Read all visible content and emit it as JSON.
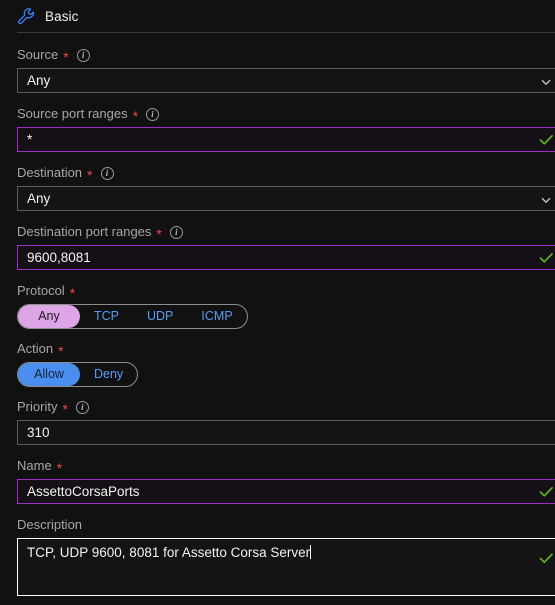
{
  "section": {
    "title": "Basic",
    "icon": "wrench-icon"
  },
  "colors": {
    "background": "#111111",
    "input_border": "#5c5c5c",
    "autofill_border": "#9b30c9",
    "focus_border": "#ffffff",
    "valid_check": "#5fb02c",
    "required_star": "#e74c4c",
    "link_blue": "#5b9bf0",
    "selected_purple": "#dda4e6",
    "selected_blue": "#4a8ff0",
    "label_text": "#a7a7a7",
    "value_text": "#f2f2f2"
  },
  "fields": {
    "source": {
      "label": "Source",
      "required": true,
      "info": true,
      "value": "Any",
      "type": "dropdown",
      "state": "default"
    },
    "source_port_ranges": {
      "label": "Source port ranges",
      "required": true,
      "info": true,
      "value": "*",
      "placeholder": "",
      "type": "text",
      "state": "autofill",
      "valid": true
    },
    "destination": {
      "label": "Destination",
      "required": true,
      "info": true,
      "value": "Any",
      "type": "dropdown",
      "state": "default"
    },
    "destination_port_ranges": {
      "label": "Destination port ranges",
      "required": true,
      "info": true,
      "value": "9600,8081",
      "placeholder": "",
      "type": "text",
      "state": "autofill",
      "valid": true
    },
    "protocol": {
      "label": "Protocol",
      "required": true,
      "info": false,
      "type": "segmented",
      "options": [
        "Any",
        "TCP",
        "UDP",
        "ICMP"
      ],
      "selected": "Any"
    },
    "action": {
      "label": "Action",
      "required": true,
      "info": false,
      "type": "segmented",
      "options": [
        "Allow",
        "Deny"
      ],
      "selected": "Allow"
    },
    "priority": {
      "label": "Priority",
      "required": true,
      "info": true,
      "value": "310",
      "placeholder": "",
      "type": "text",
      "state": "default",
      "valid": false
    },
    "name": {
      "label": "Name",
      "required": true,
      "info": false,
      "value": "AssettoCorsaPorts",
      "placeholder": "",
      "type": "text",
      "state": "autofill",
      "valid": true
    },
    "description": {
      "label": "Description",
      "required": false,
      "info": false,
      "value": "TCP, UDP 9600, 8081 for Assetto Corsa Server",
      "placeholder": "",
      "type": "textarea",
      "state": "focused",
      "valid": true,
      "caret": true
    }
  }
}
